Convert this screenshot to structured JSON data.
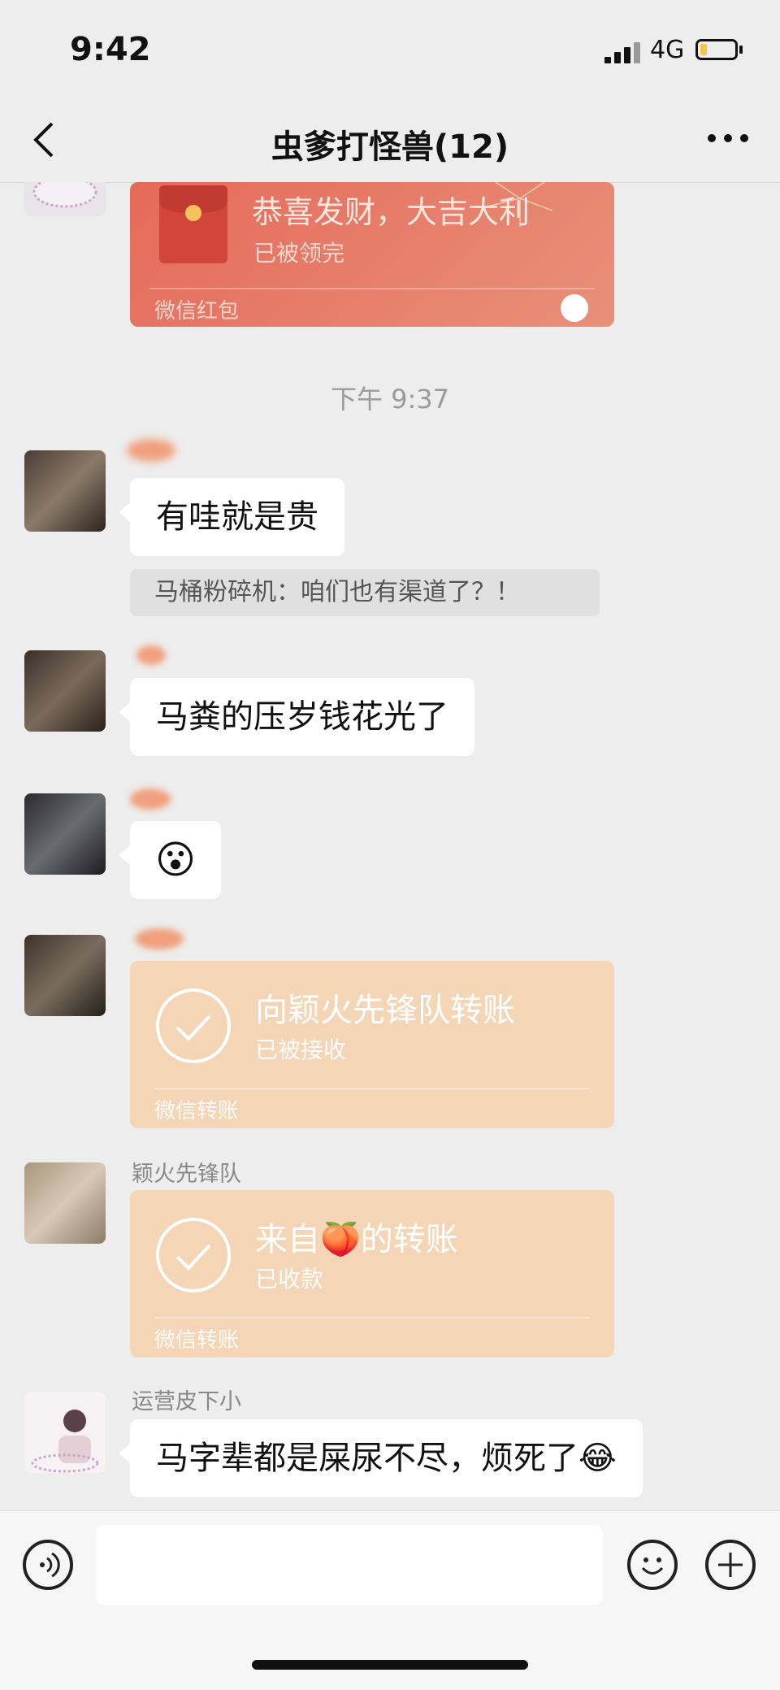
{
  "status_bar": {
    "time": "9:42",
    "network": "4G",
    "battery_icon": "battery-low-icon"
  },
  "nav": {
    "title": "虫爹打怪兽(12)",
    "back_icon": "chevron-left-icon",
    "more_icon": "more-icon"
  },
  "messages": {
    "red_packet": {
      "title": "恭喜发财，大吉大利",
      "status": "已被领完",
      "footer": "微信红包"
    },
    "timestamp": "下午 9:37",
    "msg1": {
      "text": "有哇就是贵"
    },
    "quote1": {
      "text": "马桶粉碎机：咱们也有渠道了？！"
    },
    "msg2": {
      "text": "马粪的压岁钱花光了"
    },
    "msg3": {
      "emoji": "😮"
    },
    "transfer1": {
      "title": "向颖火先锋队转账",
      "status": "已被接收",
      "footer": "微信转账"
    },
    "sender5": {
      "nickname": "颖火先锋队"
    },
    "transfer2": {
      "title": "来自🍑的转账",
      "status": "已收款",
      "footer": "微信转账"
    },
    "sender6": {
      "nickname": "运营皮下小"
    },
    "msg6": {
      "text": "马字辈都是屎尿不尽，烦死了😂"
    }
  },
  "input_bar": {
    "voice_icon": "voice-icon",
    "emoji_icon": "emoji-icon",
    "plus_icon": "plus-icon",
    "placeholder": ""
  },
  "colors": {
    "background": "#ededed",
    "bubble": "#ffffff",
    "transfer_card": "#f4d6b6",
    "red_packet": "#e56a5a"
  }
}
